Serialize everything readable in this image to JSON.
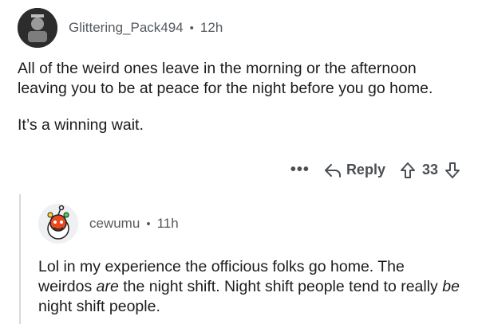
{
  "comment": {
    "username": "Glittering_Pack494",
    "separator": "•",
    "time": "12h",
    "paragraph1": "All of the weird ones leave in the morning or the afternoon leaving you to be at peace for the night before you go home.",
    "paragraph2": "It’s a winning wait.",
    "actions": {
      "more": "•••",
      "reply_label": "Reply",
      "vote_count": "33"
    }
  },
  "reply": {
    "username": "cewumu",
    "separator": "•",
    "time": "11h",
    "text_part1": "Lol in my experience the officious folks go home. The weirdos ",
    "text_em1": "are",
    "text_part2": " the night shift. Night shift people tend to really ",
    "text_em2": "be",
    "text_part3": " night shift people."
  },
  "icons": {
    "reply": "reply-arrow-icon",
    "upvote": "upvote-arrow-icon",
    "downvote": "downvote-arrow-icon",
    "more": "more-options-icon"
  }
}
